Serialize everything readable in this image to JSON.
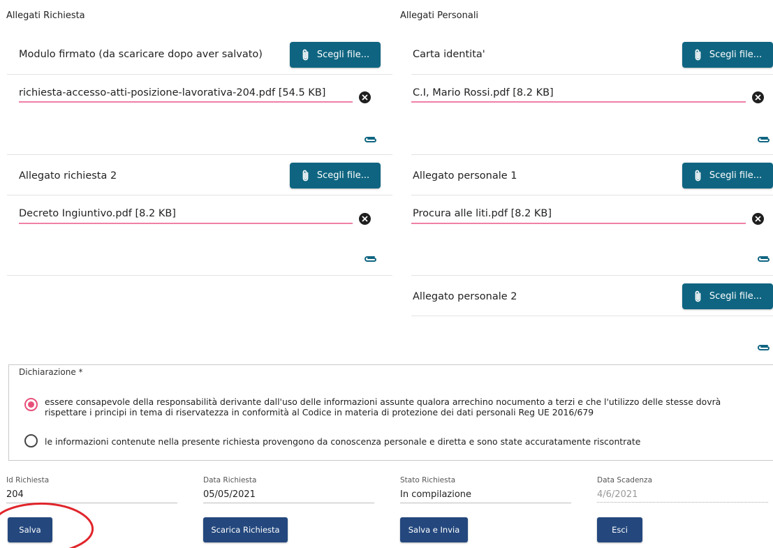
{
  "columns": {
    "left_title": "Allegati Richiesta",
    "right_title": "Allegati Personali"
  },
  "choose_file_label": "Scegli file...",
  "left_attachments": [
    {
      "label": "Modulo firmato (da scaricare dopo aver salvato)",
      "file": "richiesta-accesso-atti-posizione-lavorativa-204.pdf [54.5 KB]"
    },
    {
      "label": "Allegato richiesta 2",
      "file": "Decreto Ingiuntivo.pdf [8.2 KB]"
    }
  ],
  "right_attachments": [
    {
      "label": "Carta identita'",
      "file": "C.I, Mario Rossi.pdf [8.2 KB]"
    },
    {
      "label": "Allegato personale 1",
      "file": "Procura alle liti.pdf [8.2 KB]"
    },
    {
      "label": "Allegato personale 2",
      "file": ""
    }
  ],
  "declaration": {
    "legend": "Dichiarazione *",
    "options": [
      {
        "text": "essere consapevole della responsabilità derivante dall'uso delle informazioni assunte qualora arrechino nocumento a terzi e che l'utilizzo delle stesse dovrà rispettare i principi in tema di riservatezza in conformità al Codice in materia di protezione dei dati personali Reg UE 2016/679",
        "checked": true
      },
      {
        "text": "le informazioni contenute nella presente richiesta provengono da conoscenza personale e diretta e sono state accuratamente riscontrate",
        "checked": false
      }
    ]
  },
  "meta": {
    "id_label": "Id Richiesta",
    "id_value": "204",
    "date_label": "Data Richiesta",
    "date_value": "05/05/2021",
    "status_label": "Stato Richiesta",
    "status_value": "In compilazione",
    "due_label": "Data Scadenza",
    "due_value": "4/6/2021"
  },
  "actions": {
    "save": "Salva",
    "download": "Scarica Richiesta",
    "save_send": "Salva e Invia",
    "exit": "Esci"
  },
  "colors": {
    "file_button": "#0f6581",
    "action_button": "#24487e",
    "accent_pink": "#ef7fa7",
    "annotation_red": "#e0252b"
  },
  "icons": {
    "choose_file": "paperclip-icon",
    "remove_file": "close-circle-icon",
    "attach": "link-clip-icon"
  }
}
